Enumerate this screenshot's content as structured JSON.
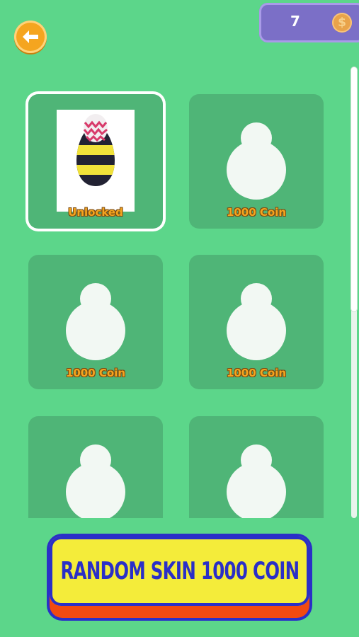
{
  "header": {
    "back_icon": "arrow-left-icon",
    "coins": "7",
    "coin_icon": "coin-icon",
    "coin_symbol": "$"
  },
  "skins": [
    {
      "label": "Unlocked",
      "state": "unlocked",
      "selected": true
    },
    {
      "label": "1000 Coin",
      "state": "locked",
      "selected": false
    },
    {
      "label": "1000 Coin",
      "state": "locked",
      "selected": false
    },
    {
      "label": "1000 Coin",
      "state": "locked",
      "selected": false
    },
    {
      "label": "",
      "state": "locked",
      "selected": false
    },
    {
      "label": "",
      "state": "locked",
      "selected": false
    }
  ],
  "random_button": {
    "label": "RANDOM SKIN 1000 COIN"
  },
  "colors": {
    "background": "#5cd68a",
    "card": "#4fb577",
    "label": "#f5a51f",
    "button_face": "#f4ec3a",
    "button_border": "#2a2fc7"
  }
}
